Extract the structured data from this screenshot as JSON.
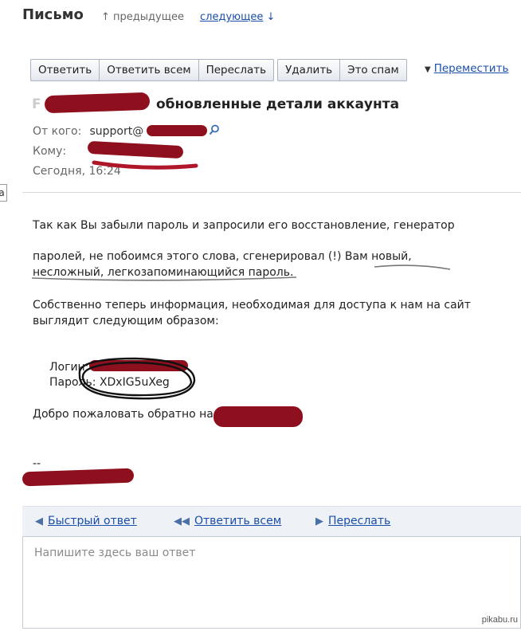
{
  "header": {
    "title": "Письмо",
    "prev": "↑ предыдущее",
    "next": "следующее",
    "next_arrow": "↓"
  },
  "toolbar": {
    "reply": "Ответить",
    "reply_all": "Ответить всем",
    "forward": "Переслать",
    "delete": "Удалить",
    "spam": "Это спам",
    "move": "Переместить"
  },
  "message": {
    "subject": "обновленные детали аккаунта",
    "from_label": "От кого:",
    "from_value": "support@",
    "to_label": "Кому:",
    "date": "Сегодня, 16:24",
    "body_p1": "Так как Вы забыли пароль и запросили его восстановление, генератор",
    "body_p2": "паролей, не побоимся этого слова, сгенерировал (!) Вам новый, несложный, легкозапоминающийся пароль.",
    "body_p3": "Собственно теперь информация, необходимая для доступа к нам на сайт выглядит следующим образом:",
    "login_label": "Логин:",
    "password_label": "Пароль:",
    "password_value": "XDxIG5uXeg",
    "welcome": "Добро пожаловать обратно на",
    "signature_sep": "--"
  },
  "quick_reply": {
    "quick": "Быстрый ответ",
    "reply_all": "Ответить всем",
    "forward": "Переслать",
    "placeholder": "Напишите здесь ваш ответ"
  },
  "side_tab": "а",
  "watermark": "pikabu.ru",
  "colors": {
    "link": "#1a4ea8",
    "redaction": "#8e0f1d"
  }
}
